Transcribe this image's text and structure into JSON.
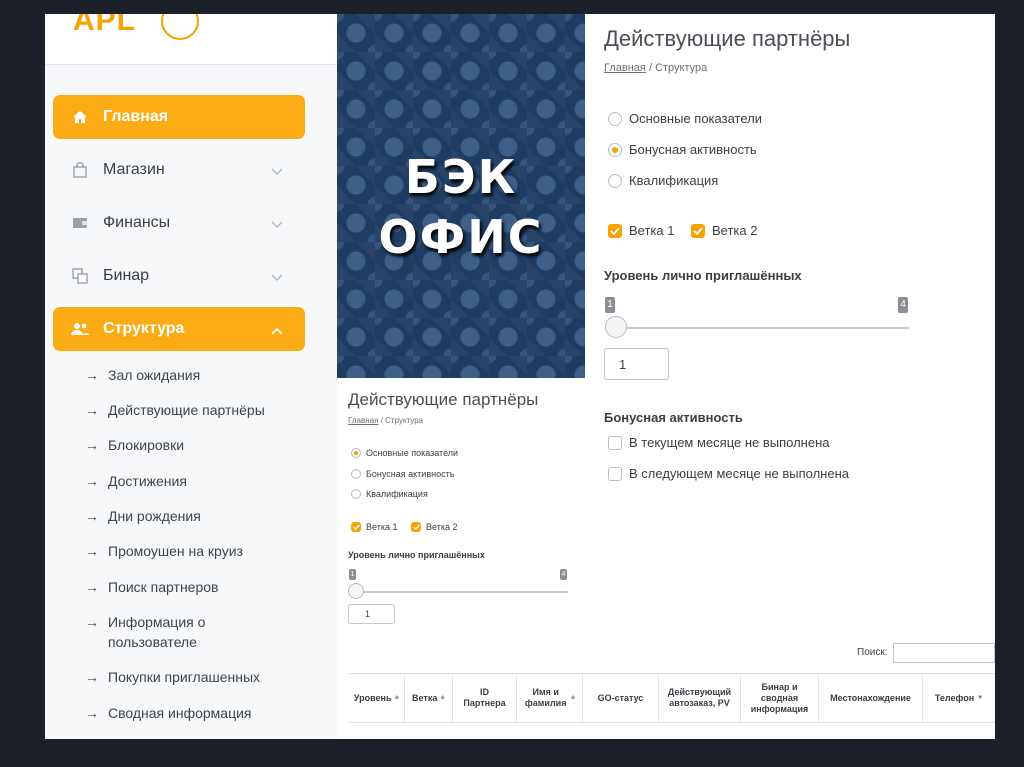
{
  "slide": {
    "title_line1": "БЭК",
    "title_line2": "ОФИС"
  },
  "sidebar": {
    "logo": "APL",
    "items": [
      {
        "label": "Главная",
        "icon": "home-icon",
        "active": true
      },
      {
        "label": "Магазин",
        "icon": "bag-icon",
        "active": false
      },
      {
        "label": "Финансы",
        "icon": "wallet-icon",
        "active": false
      },
      {
        "label": "Бинар",
        "icon": "binary-icon",
        "active": false
      },
      {
        "label": "Структура",
        "icon": "users-icon",
        "active": true
      }
    ],
    "submenu": [
      "Зал ожидания",
      "Действующие партнёры",
      "Блокировки",
      "Достижения",
      "Дни рождения",
      "Промоушен на круиз",
      "Поиск партнеров",
      "Информация о пользователе",
      "Покупки приглашенных",
      "Сводная информация"
    ],
    "arrow": "→"
  },
  "page": {
    "title": "Действующие партнёры",
    "breadcrumb_home": "Главная",
    "breadcrumb_sep": "/",
    "breadcrumb_current": "Структура",
    "radio_options": [
      {
        "label": "Основные показатели"
      },
      {
        "label": "Бонусная активность"
      },
      {
        "label": "Квалификация"
      }
    ],
    "branches": [
      {
        "label": "Ветка 1",
        "checked": true
      },
      {
        "label": "Ветка 2",
        "checked": true
      }
    ],
    "invited_level": {
      "label": "Уровень лично приглашённых",
      "min": "1",
      "max": "4",
      "value": "1"
    },
    "bonus_activity": {
      "label": "Бонусная активность",
      "options": [
        {
          "label": "В текущем месяце не выполнена",
          "checked": false
        },
        {
          "label": "В следующем месяце не выполнена",
          "checked": false
        }
      ]
    }
  },
  "small_page": {
    "selected_radio": "Основные показатели"
  },
  "right_page": {
    "selected_radio": "Бонусная активность"
  },
  "table": {
    "search_label": "Поиск:",
    "search_value": "",
    "columns": [
      "Уровень",
      "Ветка",
      "ID Партнера",
      "Имя и фамилия",
      "GO-статус",
      "Действующий автозаказ, PV",
      "Бинар и сводная информация",
      "Местонахождение",
      "Телефон"
    ]
  },
  "colors": {
    "accent": "#fbab13",
    "wallpaper": "#1f3c63"
  }
}
